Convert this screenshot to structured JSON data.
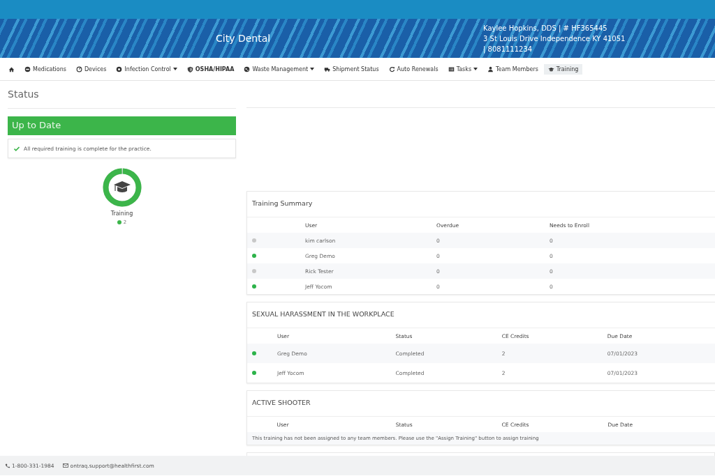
{
  "header": {
    "practice_name": "City Dental",
    "contact_lines": [
      "Kaylee Hopkins, DDS | # HF365445",
      "3 St Louis Drive Independence KY 41051",
      "| 8081111234"
    ]
  },
  "nav": [
    {
      "dropdown": false,
      "selected": false
    },
    {
      "label": "Medications",
      "dropdown": false,
      "selected": false
    },
    {
      "label": "Devices",
      "dropdown": false,
      "selected": false
    },
    {
      "label": "Infection Control",
      "dropdown": true,
      "selected": false
    },
    {
      "label": "OSHA/HIPAA",
      "dropdown": false,
      "selected": false
    },
    {
      "label": "Waste Management",
      "dropdown": true,
      "selected": false
    },
    {
      "label": "Shipment Status",
      "dropdown": false,
      "selected": false
    },
    {
      "label": "Auto Renewals",
      "dropdown": false,
      "selected": false
    },
    {
      "label": "Tasks",
      "dropdown": true,
      "selected": false
    },
    {
      "label": "Team Members",
      "dropdown": false,
      "selected": false
    },
    {
      "label": "Training",
      "dropdown": false,
      "selected": true
    }
  ],
  "status": {
    "heading": "Status",
    "banner": "Up to Date",
    "message": "All required training is complete for the practice.",
    "gauge": {
      "label": "Training",
      "level": 1
    },
    "count": "2"
  },
  "summary": {
    "title": "Training Summary",
    "columns": [
      "User",
      "Overdue",
      "Needs to Enroll"
    ],
    "rows": [
      {
        "color": "#c8c8c8",
        "cells": [
          "kim carlson",
          "0",
          "0"
        ]
      },
      {
        "color": "#2db34a",
        "cells": [
          "Greg Demo",
          "0",
          "0"
        ]
      },
      {
        "color": "#c8c8c8",
        "cells": [
          "Rick Tester",
          "0",
          "0"
        ]
      },
      {
        "color": "#2db34a",
        "cells": [
          "Jeff Yocom",
          "0",
          "0"
        ]
      }
    ]
  },
  "courses": [
    {
      "title": "SEXUAL HARASSMENT IN THE WORKPLACE",
      "columns": [
        "User",
        "Status",
        "CE Credits",
        "Due Date"
      ],
      "rows": [
        {
          "color": "#2db34a",
          "cells": [
            "Greg Demo",
            "Completed",
            "2",
            "07/01/2023"
          ]
        },
        {
          "color": "#2db34a",
          "cells": [
            "Jeff Yocom",
            "Completed",
            "2",
            "07/01/2023"
          ]
        }
      ]
    },
    {
      "title": "ACTIVE SHOOTER",
      "columns": [
        "User",
        "Status",
        "CE Credits",
        "Due Date"
      ],
      "empty_message": "This training has not been assigned to any team members. Please use the \"Assign Training\" button to assign training"
    }
  ],
  "footer": {
    "phone": "1-800-331-1984",
    "email": "ontraq.support@healthfirst.com"
  }
}
